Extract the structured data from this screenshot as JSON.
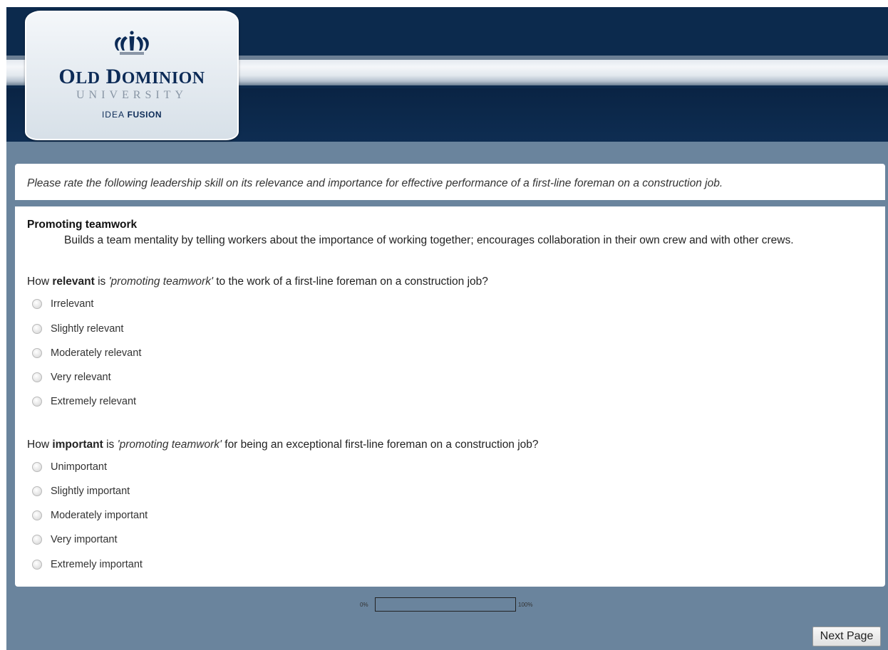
{
  "header": {
    "logo": {
      "crown_icon": "crown-icon",
      "line1_big_o": "O",
      "line1_ld": "LD",
      "line1_space": " ",
      "line1_big_d": "D",
      "line1_ominion": "OMINION",
      "line2": "UNIVERSITY",
      "line3_a": "IDEA",
      "line3_b": "FUSION"
    },
    "colors": {
      "header_dark": "#0c2a4d",
      "page_bg": "#6a849d"
    }
  },
  "survey": {
    "intro": "Please rate the following leadership skill on its relevance and importance for effective performance of a first-line foreman on a construction job.",
    "skill": {
      "title": "Promoting teamwork",
      "description": "Builds a team mentality by telling workers about the importance of working together; encourages collaboration in their own crew and with other crews."
    },
    "q1": {
      "prefix": "How ",
      "bold": "relevant",
      "mid": " is ",
      "italic": "'promoting teamwork'",
      "suffix": " to the work of a first-line foreman on a construction job?",
      "options": [
        "Irrelevant",
        "Slightly relevant",
        "Moderately relevant",
        "Very relevant",
        "Extremely relevant"
      ]
    },
    "q2": {
      "prefix": "How ",
      "bold": "important",
      "mid": " is ",
      "italic": "'promoting teamwork'",
      "suffix": " for being an exceptional first-line foreman on a construction job?",
      "options": [
        "Unimportant",
        "Slightly important",
        "Moderately important",
        "Very important",
        "Extremely important"
      ]
    }
  },
  "progress": {
    "min_label": "0%",
    "max_label": "100%",
    "value_percent": 0
  },
  "next_button": {
    "label": "Next Page"
  }
}
